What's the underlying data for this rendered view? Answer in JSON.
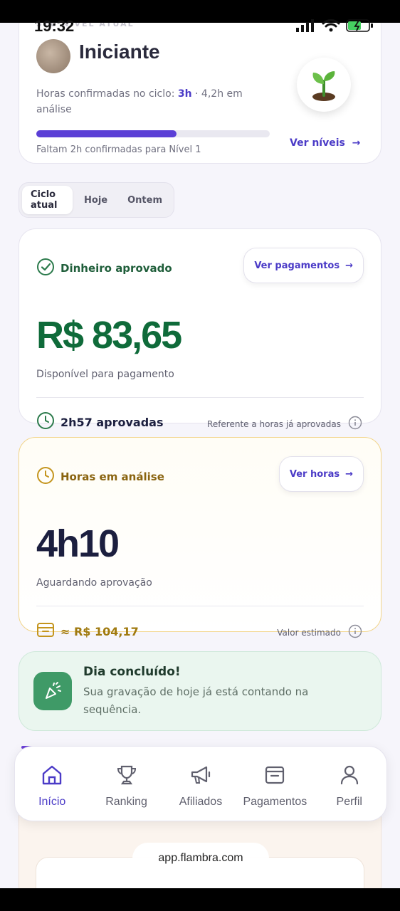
{
  "status_bar": {
    "time": "19:32"
  },
  "level_card": {
    "caption": "SEU NÍVEL ATUAL",
    "title": "Iniciante",
    "hours_prefix": "Horas confirmadas no ciclo: ",
    "hours_bold": "3h",
    "hours_suffix": " · 4,2h em análise",
    "progress_fraction": 0.6,
    "ver_niveis": "Ver níveis",
    "faltam": "Faltam 2h confirmadas para Nível 1"
  },
  "tabs": [
    "Ciclo atual",
    "Hoje",
    "Ontem"
  ],
  "money_card": {
    "title": "Dinheiro aprovado",
    "button": "Ver pagamentos",
    "value": "R$ 83,65",
    "sub": "Disponível para pagamento",
    "approved": "2h57 aprovadas",
    "note": "Referente a horas já aprovadas"
  },
  "hours_card": {
    "title": "Horas em análise",
    "button": "Ver horas",
    "value": "4h10",
    "sub": "Aguardando aprovação",
    "estimate": "≈ R$ 104,17",
    "note": "Valor estimado"
  },
  "day_card": {
    "title": "Dia concluído!",
    "text": "Sua gravação de hoje já está contando na sequência."
  },
  "nav": {
    "inicio": "Início",
    "ranking": "Ranking",
    "afiliados": "Afiliados",
    "pagamentos": "Pagamentos",
    "perfil": "Perfil"
  },
  "url": "app.flambra.com",
  "colors": {
    "accent": "#4b3bc7",
    "money_green": "#0f6b3a",
    "hours_gold": "#a07a10",
    "navy": "#1c1f3f"
  }
}
